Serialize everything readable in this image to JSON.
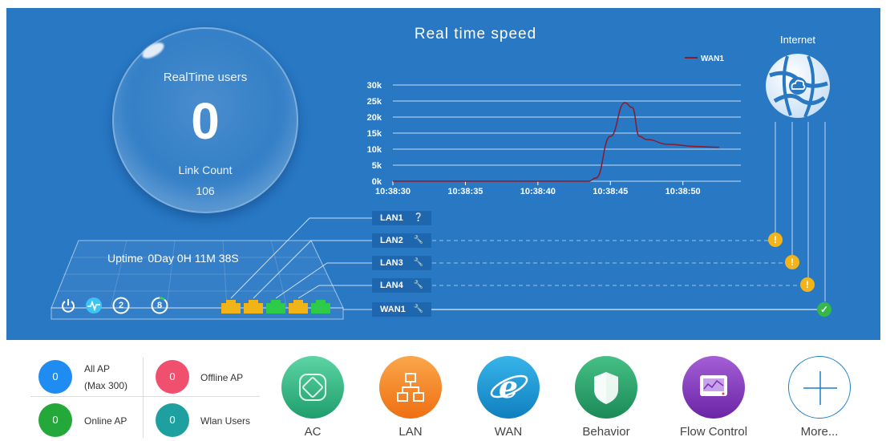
{
  "realtime": {
    "title": "RealTime users",
    "users": "0",
    "link_count_label": "Link Count",
    "link_count": "106"
  },
  "speed": {
    "title": "Real time speed"
  },
  "chart_data": {
    "type": "line",
    "title": "Real time speed",
    "x": [
      "10:38:30",
      "10:38:35",
      "10:38:40",
      "10:38:45",
      "10:38:50"
    ],
    "y_ticks": [
      "0k",
      "5k",
      "10k",
      "15k",
      "20k",
      "25k",
      "30k"
    ],
    "ylim": [
      0,
      30000
    ],
    "series": [
      {
        "name": "WAN1",
        "color": "#8b1a2b",
        "points": [
          [
            0,
            0
          ],
          [
            5,
            0
          ],
          [
            10,
            0
          ],
          [
            13.5,
            0
          ],
          [
            14,
            1000
          ],
          [
            15,
            14000
          ],
          [
            16,
            24500
          ],
          [
            16.5,
            23000
          ],
          [
            17,
            14000
          ],
          [
            17.5,
            13000
          ],
          [
            19,
            11500
          ],
          [
            21,
            10800
          ],
          [
            22.5,
            10600
          ]
        ]
      }
    ],
    "x_unit": "seconds since 10:38:30",
    "grid": true,
    "legend": "top-right"
  },
  "internet": {
    "label": "Internet",
    "icon": "globe-cloud-icon"
  },
  "device": {
    "uptime_label": "Uptime",
    "uptime_value": "0Day 0H 11M 38S",
    "cpu_badge": "2",
    "mem_badge": "8",
    "ports": [
      {
        "color": "#f0b418"
      },
      {
        "color": "#f0b418"
      },
      {
        "color": "#2ecb4a"
      },
      {
        "color": "#f0b418"
      },
      {
        "color": "#2ecb4a"
      }
    ]
  },
  "links": [
    {
      "name": "LAN1",
      "icon": "question-icon",
      "status": "none"
    },
    {
      "name": "LAN2",
      "icon": "wrench-icon",
      "status": "warn"
    },
    {
      "name": "LAN3",
      "icon": "wrench-icon",
      "status": "warn"
    },
    {
      "name": "LAN4",
      "icon": "wrench-icon",
      "status": "warn"
    },
    {
      "name": "WAN1",
      "icon": "wrench-icon",
      "status": "ok"
    }
  ],
  "stats": {
    "all_ap": {
      "value": "0",
      "label": "All AP",
      "sub": "(Max 300)",
      "color": "#1e8cf0"
    },
    "offline_ap": {
      "value": "0",
      "label": "Offline AP",
      "color": "#f0506e"
    },
    "online_ap": {
      "value": "0",
      "label": "Online AP",
      "color": "#24a83a"
    },
    "wlan_users": {
      "value": "0",
      "label": "Wlan Users",
      "color": "#1ea0a0"
    }
  },
  "apps": [
    {
      "label": "AC",
      "icon": "ac-icon",
      "color": "#3db88a"
    },
    {
      "label": "LAN",
      "icon": "lan-icon",
      "color": "#f5821f"
    },
    {
      "label": "WAN",
      "icon": "wan-icon",
      "color": "#1a9ad6"
    },
    {
      "label": "Behavior",
      "icon": "shield-icon",
      "color": "#2aa36a"
    },
    {
      "label": "Flow Control",
      "icon": "monitor-icon",
      "color": "#8a3fc0"
    },
    {
      "label": "More...",
      "icon": "plus-icon",
      "color": "#1a7fc8"
    }
  ]
}
